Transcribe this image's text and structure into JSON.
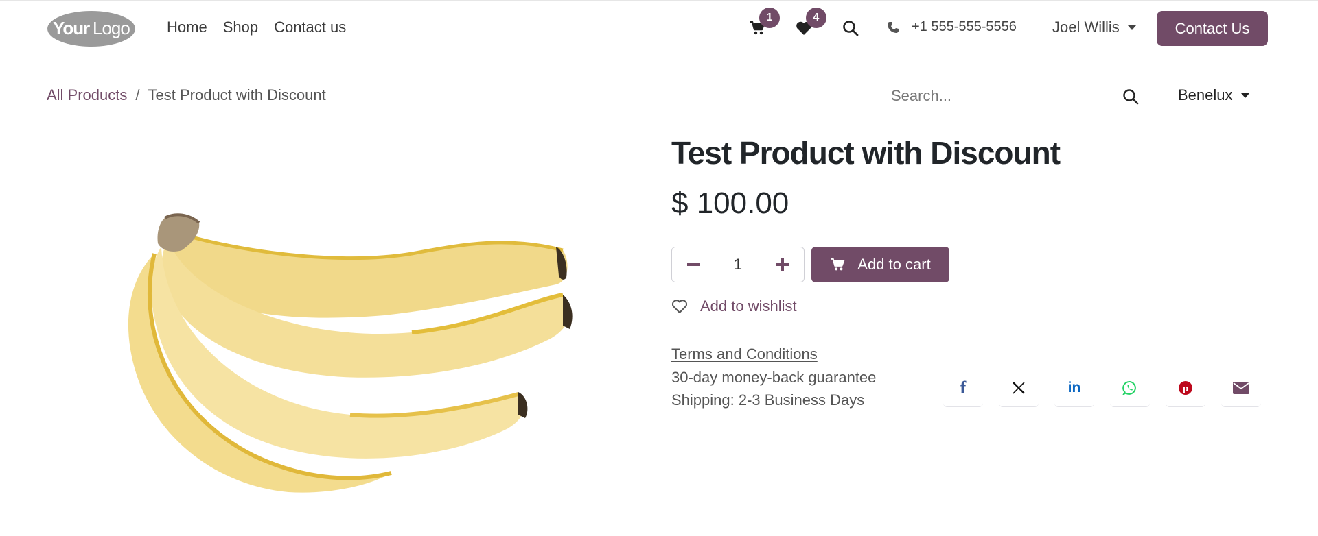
{
  "header": {
    "logo_text": "YourLogo",
    "nav": [
      "Home",
      "Shop",
      "Contact us"
    ],
    "cart_count": "1",
    "wishlist_count": "4",
    "phone": "+1 555-555-5556",
    "user": "Joel Willis",
    "cta": "Contact Us"
  },
  "breadcrumb": {
    "parent": "All Products",
    "separator": "/",
    "current": "Test Product with Discount"
  },
  "search": {
    "placeholder": "Search..."
  },
  "pricelist": "Benelux",
  "product": {
    "name": "Test Product with Discount",
    "price": "$ 100.00",
    "quantity": "1",
    "add_to_cart": "Add to cart",
    "add_to_wishlist": "Add to wishlist",
    "terms": "Terms and Conditions",
    "guarantee": "30-day money-back guarantee",
    "shipping": "Shipping: 2-3 Business Days"
  },
  "share": {
    "facebook": "f",
    "linkedin": "in"
  },
  "colors": {
    "accent": "#714b67",
    "text": "#212529",
    "facebook": "#3b5998",
    "linkedin": "#0a66c2",
    "whatsapp": "#25d366",
    "pinterest": "#bd081c",
    "email": "#714b67"
  }
}
